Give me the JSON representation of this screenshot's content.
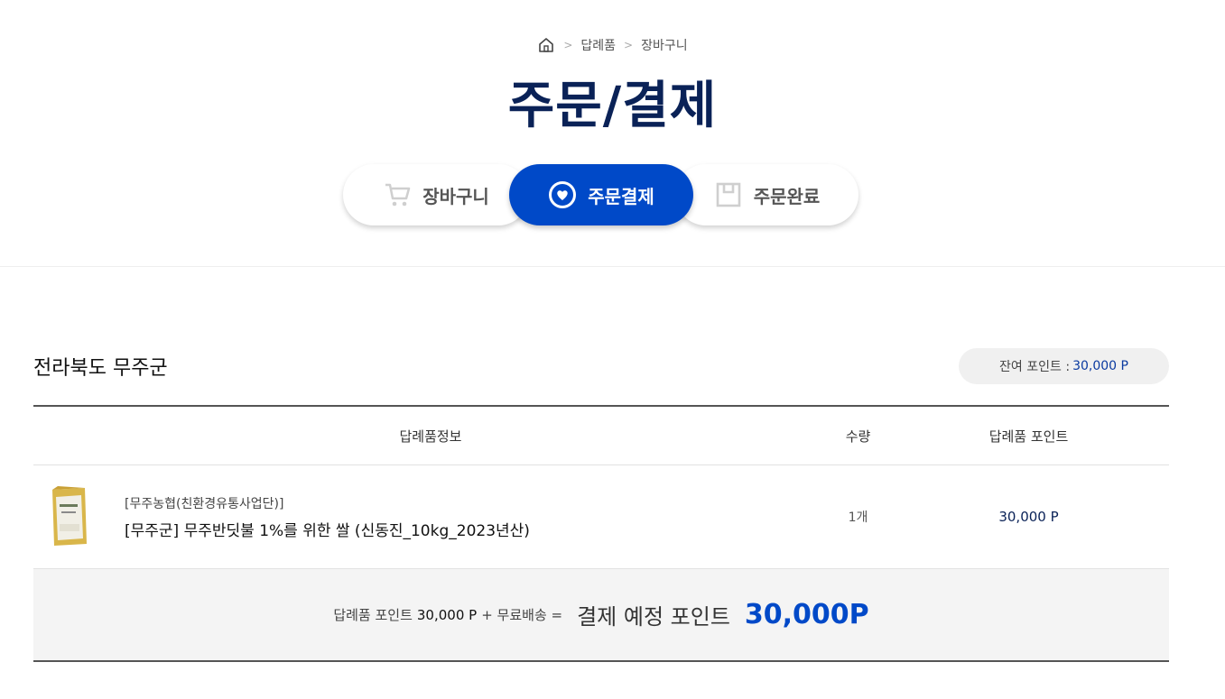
{
  "breadcrumb": {
    "items": [
      "답례품",
      "장바구니"
    ]
  },
  "page": {
    "title": "주문/결제"
  },
  "steps": [
    {
      "label": "장바구니",
      "icon": "cart-icon"
    },
    {
      "label": "주문결제",
      "icon": "heart-circle-icon",
      "active": true
    },
    {
      "label": "주문완료",
      "icon": "box-icon"
    }
  ],
  "section": {
    "region": "전라북도 무주군",
    "points_label": "잔여 포인트 :",
    "points_value": "30,000 P"
  },
  "table": {
    "headers": {
      "info": "답례품정보",
      "qty": "수량",
      "point": "답례품 포인트"
    },
    "rows": [
      {
        "vendor": "[무주농협(친환경유통사업단)]",
        "name": "[무주군] 무주반딧불 1%를 위한 쌀 (신동진_10kg_2023년산)",
        "qty": "1개",
        "point": "30,000 P"
      }
    ]
  },
  "summary": {
    "point_label": "답례품 포인트",
    "point_value": "30,000 P",
    "shipping": "+ 무료배송 =",
    "total_label": "결제 예정 포인트",
    "total_value": "30,000P"
  },
  "colors": {
    "accent": "#0049c8",
    "title": "#0a2257"
  }
}
